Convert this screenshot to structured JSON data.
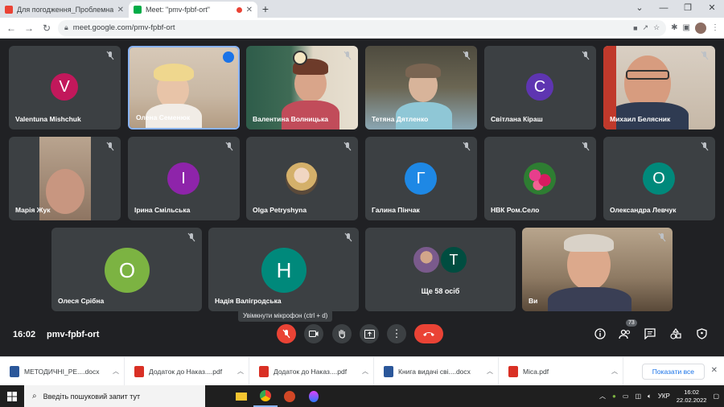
{
  "browser": {
    "tabs": [
      {
        "title": "Для погодження_Проблемна гр",
        "active": false
      },
      {
        "title": "Meet: \"pmv-fpbf-ort\"",
        "active": true
      }
    ],
    "url": "meet.google.com/pmv-fpbf-ort"
  },
  "participants": [
    {
      "name": "Valentuna Mishchuk",
      "initial": "V",
      "color": "#c2185b"
    },
    {
      "name": "Олена Семенюк",
      "video": true
    },
    {
      "name": "Валентина Волницька",
      "video": true
    },
    {
      "name": "Тетяна Дятленко",
      "video": true
    },
    {
      "name": "Світлана Кіраш",
      "initial": "C",
      "color": "#5e35b1"
    },
    {
      "name": "Михаил Белясник",
      "video": true
    },
    {
      "name": "Марія Жук",
      "video": true
    },
    {
      "name": "Ірина Смільська",
      "initial": "І",
      "color": "#8e24aa"
    },
    {
      "name": "Olga Petryshyna",
      "photo": true
    },
    {
      "name": "Галина Пінчак",
      "initial": "Г",
      "color": "#1e88e5"
    },
    {
      "name": "НВК Ром.Село",
      "photo": true
    },
    {
      "name": "Олександра Левчук",
      "initial": "О",
      "color": "#00897b"
    },
    {
      "name": "Олеся Срібна",
      "initial": "О",
      "color": "#7cb342"
    },
    {
      "name": "Надія Валігродська",
      "initial": "Н",
      "color": "#00897b"
    },
    {
      "name": "Ще 58 осіб",
      "initial": "Т",
      "color": "#004d40"
    },
    {
      "name": "Ви",
      "video": true
    }
  ],
  "meeting": {
    "time": "16:02",
    "code": "pmv-fpbf-ort",
    "tooltip": "Увімкнути мікрофон (ctrl + d)",
    "participants_count": "73"
  },
  "downloads": [
    {
      "name": "МЕТОДИЧНІ_РЕ....docx",
      "type": "docx"
    },
    {
      "name": "Додаток до Наказ....pdf",
      "type": "pdf"
    },
    {
      "name": "Додаток до Наказ....pdf",
      "type": "pdf"
    },
    {
      "name": "Книга видачі сві....docx",
      "type": "docx"
    },
    {
      "name": "Міса.pdf",
      "type": "pdf"
    }
  ],
  "downloads_show_all": "Показати все",
  "taskbar": {
    "search_placeholder": "Введіть пошуковий запит тут",
    "lang": "УКР",
    "time": "16:02",
    "date": "22.02.2022"
  }
}
